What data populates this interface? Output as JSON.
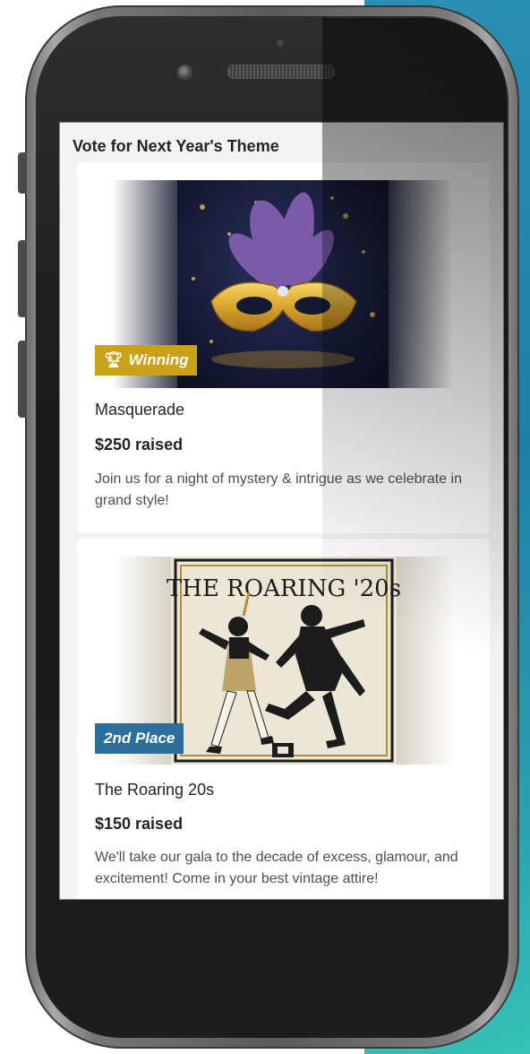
{
  "colors": {
    "accent": "#1f7fa6",
    "winning_badge": "#c9a21a",
    "second_badge": "#2d6f9a"
  },
  "screen": {
    "title": "Vote for Next Year's Theme"
  },
  "themes": [
    {
      "name": "Masquerade",
      "raised": "$250 raised",
      "badge": "Winning",
      "badge_icon": "trophy-icon",
      "description": "Join us for a night of mystery & intrigue as we celebrate in grand style!"
    },
    {
      "name": "The Roaring 20s",
      "raised": "$150 raised",
      "badge": "2nd Place",
      "image_text": "THE ROARING '20s",
      "description": "We'll take our gala to the decade of excess, glamour, and excitement! Come in your best vintage attire!"
    }
  ]
}
